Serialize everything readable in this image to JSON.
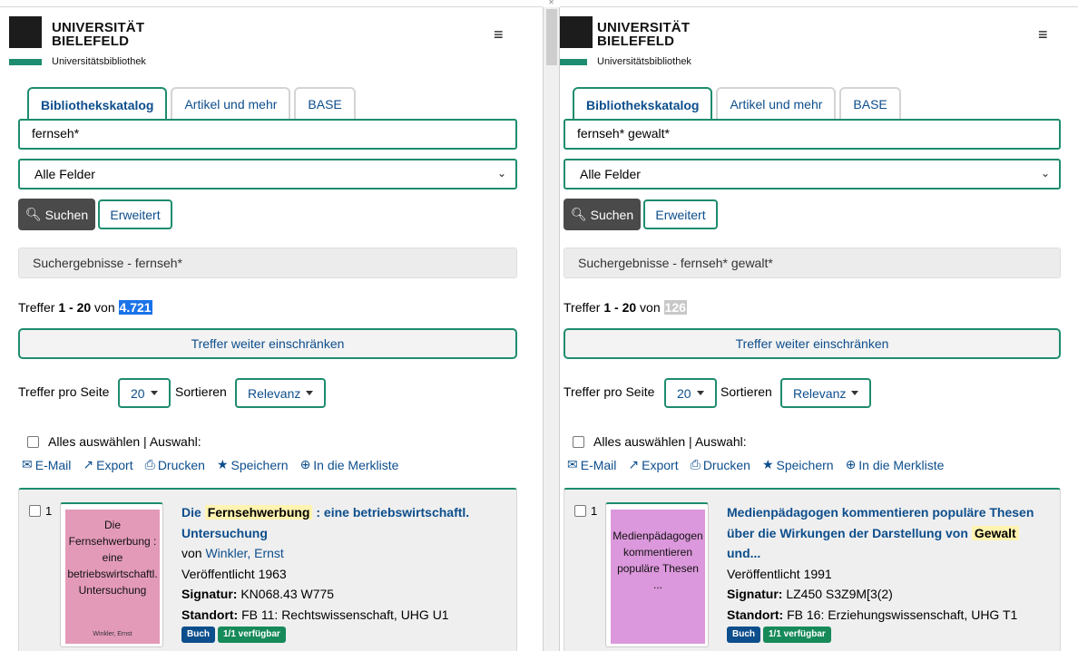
{
  "panes": {
    "left": {
      "logo": {
        "line1": "UNIVERSITÄT",
        "line2": "BIELEFELD",
        "subtitle": "Universitätsbibliothek"
      },
      "menu_icon": "≡",
      "tabs": [
        "Bibliothekskatalog",
        "Artikel und mehr",
        "BASE"
      ],
      "search_value": "fernseh*",
      "field_select": "Alle Felder",
      "search_button": "Suchen",
      "advanced_button": "Erweitert",
      "results_title": "Suchergebnisse - fernseh*",
      "hits": {
        "prefix": "Treffer ",
        "range": "1 - 20",
        "of": " von ",
        "total": "4.721"
      },
      "refine_button": "Treffer weiter einschränken",
      "per_page_label": "Treffer pro Seite",
      "per_page_value": "20",
      "sort_label": "Sortieren",
      "sort_value": "Relevanz",
      "select_all": "Alles auswählen | Auswahl:",
      "actions": [
        "E-Mail",
        "Export",
        "Drucken",
        "Speichern",
        "In die Merkliste"
      ],
      "result": {
        "number": "1",
        "cover_text": "Die Fernsehwerbung : eine betriebswirtschaftl. Untersuchung",
        "cover_author": "Winkler, Ernst",
        "cover_color": "#e39ab9",
        "title_pre": "Die ",
        "title_mark": "Fernsehwerbung",
        "title_post": " : eine betriebswirtschaftl. Untersuchung",
        "by_label": "von ",
        "author": "Winkler, Ernst",
        "published": "Veröffentlicht 1963",
        "signatur_label": "Signatur:",
        "signatur": " KN068.43 W775",
        "standort_label": "Standort:",
        "standort": " FB 11: Rechtswissenschaft, UHG U1",
        "badge_type": "Buch",
        "badge_avail": "1/1 verfügbar"
      }
    },
    "right": {
      "logo": {
        "line1": "UNIVERSITÄT",
        "line2": "BIELEFELD",
        "subtitle": "Universitätsbibliothek"
      },
      "menu_icon": "≡",
      "tabs": [
        "Bibliothekskatalog",
        "Artikel und mehr",
        "BASE"
      ],
      "search_value": "fernseh* gewalt*",
      "field_select": "Alle Felder",
      "search_button": "Suchen",
      "advanced_button": "Erweitert",
      "results_title": "Suchergebnisse - fernseh* gewalt*",
      "hits": {
        "prefix": "Treffer ",
        "range": "1 - 20",
        "of": " von ",
        "total": "126"
      },
      "refine_button": "Treffer weiter einschränken",
      "per_page_label": "Treffer pro Seite",
      "per_page_value": "20",
      "sort_label": "Sortieren",
      "sort_value": "Relevanz",
      "select_all": "Alles auswählen | Auswahl:",
      "actions": [
        "E-Mail",
        "Export",
        "Drucken",
        "Speichern",
        "In die Merkliste"
      ],
      "result": {
        "number": "1",
        "cover_text": "Medienpädagogen kommentieren populäre Thesen ...",
        "cover_color": "#dc98dc",
        "title_pre": "Medienpädagogen kommentieren populäre Thesen über die Wirkungen der Darstellung von ",
        "title_mark": "Gewalt",
        "title_post": " und...",
        "published": "Veröffentlicht 1991",
        "signatur_label": "Signatur:",
        "signatur": " LZ450 S3Z9M[3(2)",
        "standort_label": "Standort:",
        "standort": " FB 16: Erziehungswissenschaft, UHG T1",
        "badge_type": "Buch",
        "badge_avail": "1/1 verfügbar"
      }
    }
  },
  "colors": {
    "accent": "#1e8c6e",
    "link": "#0d4e8c",
    "highlight_selected": "#1a73e8",
    "mark": "#fff3b0"
  }
}
